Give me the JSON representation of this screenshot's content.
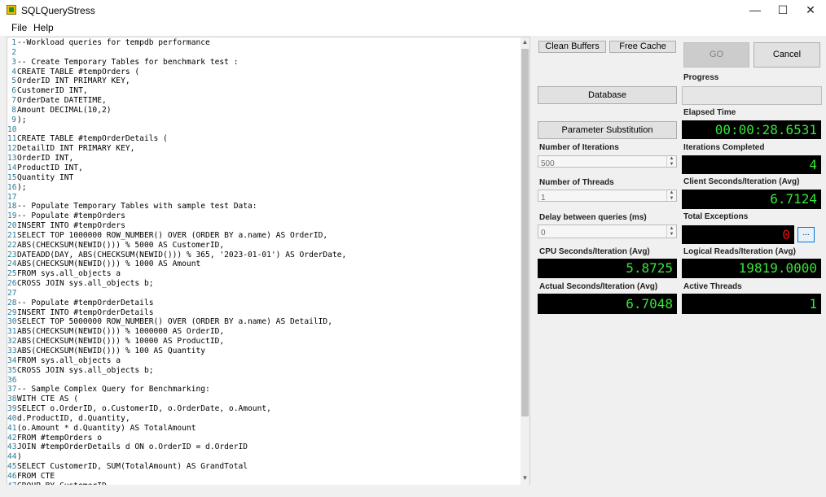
{
  "window": {
    "title": "SQLQueryStress",
    "minimize": "—",
    "maximize": "☐",
    "close": "✕"
  },
  "menu": {
    "file": "File",
    "help": "Help"
  },
  "editor": {
    "lines": [
      "--Workload queries for tempdb performance",
      "",
      "-- Create Temporary Tables for benchmark test :",
      "CREATE TABLE #tempOrders (",
      "OrderID INT PRIMARY KEY,",
      "CustomerID INT,",
      "OrderDate DATETIME,",
      "Amount DECIMAL(10,2)",
      ");",
      "",
      "CREATE TABLE #tempOrderDetails (",
      "DetailID INT PRIMARY KEY,",
      "OrderID INT,",
      "ProductID INT,",
      "Quantity INT",
      ");",
      "",
      "-- Populate Temporary Tables with sample test Data:",
      "-- Populate #tempOrders",
      "INSERT INTO #tempOrders",
      "SELECT TOP 1000000 ROW_NUMBER() OVER (ORDER BY a.name) AS OrderID,",
      "ABS(CHECKSUM(NEWID())) % 5000 AS CustomerID,",
      "DATEADD(DAY, ABS(CHECKSUM(NEWID())) % 365, '2023-01-01') AS OrderDate,",
      "ABS(CHECKSUM(NEWID())) % 1000 AS Amount",
      "FROM sys.all_objects a",
      "CROSS JOIN sys.all_objects b;",
      "",
      "-- Populate #tempOrderDetails",
      "INSERT INTO #tempOrderDetails",
      "SELECT TOP 5000000 ROW_NUMBER() OVER (ORDER BY a.name) AS DetailID,",
      "ABS(CHECKSUM(NEWID())) % 1000000 AS OrderID,",
      "ABS(CHECKSUM(NEWID())) % 10000 AS ProductID,",
      "ABS(CHECKSUM(NEWID())) % 100 AS Quantity",
      "FROM sys.all_objects a",
      "CROSS JOIN sys.all_objects b;",
      "",
      "-- Sample Complex Query for Benchmarking:",
      "WITH CTE AS (",
      "SELECT o.OrderID, o.CustomerID, o.OrderDate, o.Amount,",
      "d.ProductID, d.Quantity,",
      "(o.Amount * d.Quantity) AS TotalAmount",
      "FROM #tempOrders o",
      "JOIN #tempOrderDetails d ON o.OrderID = d.OrderID",
      ")",
      "SELECT CustomerID, SUM(TotalAmount) AS GrandTotal",
      "FROM CTE",
      "GROUP BY CustomerID"
    ]
  },
  "buttons": {
    "clean_buffers": "Clean Buffers",
    "free_cache": "Free Cache",
    "go": "GO",
    "cancel": "Cancel",
    "database": "Database",
    "parameter_substitution": "Parameter Substitution",
    "exceptions_detail": "..."
  },
  "labels": {
    "progress": "Progress",
    "elapsed_time": "Elapsed Time",
    "number_of_iterations": "Number of Iterations",
    "iterations_completed": "Iterations Completed",
    "number_of_threads": "Number of Threads",
    "client_seconds": "Client Seconds/Iteration (Avg)",
    "delay": "Delay between queries (ms)",
    "total_exceptions": "Total Exceptions",
    "cpu_seconds": "CPU Seconds/Iteration (Avg)",
    "logical_reads": "Logical Reads/Iteration (Avg)",
    "actual_seconds": "Actual Seconds/Iteration (Avg)",
    "active_threads": "Active Threads"
  },
  "inputs": {
    "iterations": "500",
    "threads": "1",
    "delay": "0"
  },
  "stats": {
    "elapsed_time": "00:00:28.6531",
    "iterations_completed": "4",
    "client_seconds": "6.7124",
    "total_exceptions": "0",
    "cpu_seconds": "5.8725",
    "logical_reads": "19819.0000",
    "actual_seconds": "6.7048",
    "active_threads": "1"
  },
  "progress": {
    "value": 0
  },
  "colors": {
    "display_text": "#37e637",
    "exception_text": "#e81010",
    "line_numbers": "#2b7a9a"
  }
}
